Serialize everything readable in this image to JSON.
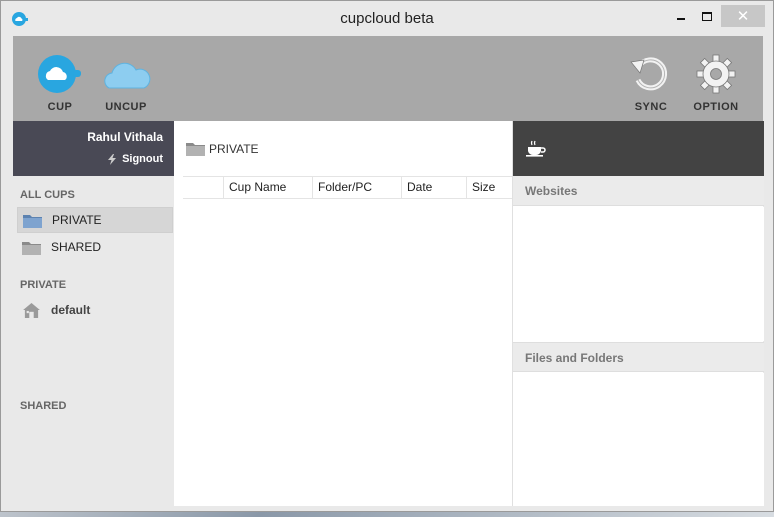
{
  "window": {
    "title": "cupcloud beta",
    "close_glyph": "✕"
  },
  "toolbar": {
    "cup_label": "CUP",
    "uncup_label": "UNCUP",
    "sync_label": "SYNC",
    "option_label": "OPTION"
  },
  "user": {
    "name": "Rahul Vithala",
    "signout_label": "Signout"
  },
  "sidebar": {
    "all_cups_title": "ALL CUPS",
    "all_cups_items": [
      {
        "label": "PRIVATE",
        "icon": "folder-blue-icon",
        "active": true
      },
      {
        "label": "SHARED",
        "icon": "folder-gray-icon",
        "active": false
      }
    ],
    "private_title": "PRIVATE",
    "private_items": [
      {
        "label": "default",
        "icon": "house-icon"
      }
    ],
    "shared_title": "SHARED"
  },
  "content": {
    "current_folder": "PRIVATE",
    "columns": [
      "",
      "Cup Name",
      "Folder/PC",
      "Date",
      "Size"
    ],
    "rows": []
  },
  "right_panel": {
    "header_icon": "coffee-cup-icon",
    "websites_title": "Websites",
    "files_title": "Files and Folders"
  },
  "colors": {
    "toolbar_bg": "#a8a8a8",
    "user_panel_bg": "#494955",
    "right_header_bg": "#434343",
    "cloud_accent": "#29a6e0",
    "cloud_light": "#8dcdf0"
  }
}
